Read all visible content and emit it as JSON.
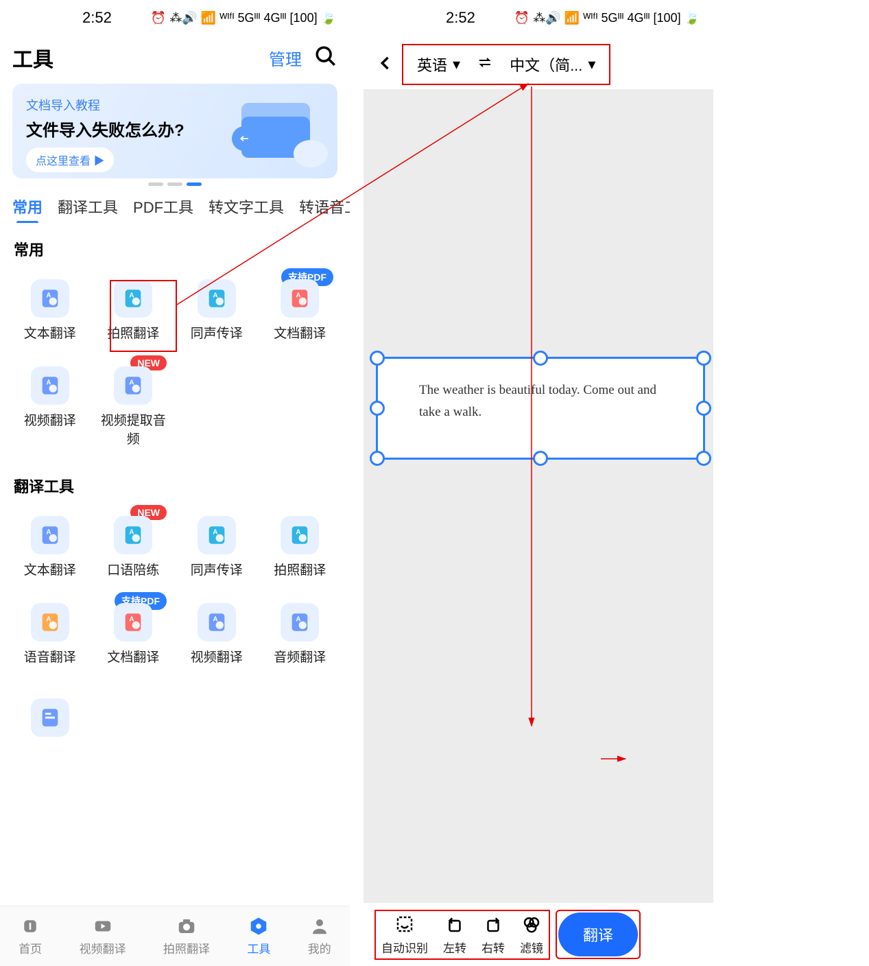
{
  "status": {
    "time": "2:52",
    "icons": "⏰ ⁂🔊 📶 ᵂᴵᶠᴵ 5Gᴵᴵᴵ 4Gᴵᴵᴵ [100] 🍃"
  },
  "left": {
    "title": "工具",
    "manage": "管理",
    "banner": {
      "sub": "文档导入教程",
      "title": "文件导入失败怎么办?",
      "btn": "点这里查看 ▶"
    },
    "tabs": [
      "常用",
      "翻译工具",
      "PDF工具",
      "转文字工具",
      "转语音工具"
    ],
    "section1": "常用",
    "tools1": [
      {
        "label": "文本翻译",
        "color": "#6E9BFF"
      },
      {
        "label": "拍照翻译",
        "color": "#2FB5E8"
      },
      {
        "label": "同声传译",
        "color": "#2FB5E8"
      },
      {
        "label": "文档翻译",
        "color": "#FF6B6B",
        "badge": "支持PDF",
        "badgeClass": "blue"
      },
      {
        "label": "视频翻译",
        "color": "#6E9BFF"
      },
      {
        "label": "视频提取音频",
        "color": "#6E9BFF",
        "badge": "NEW",
        "badgeClass": "red"
      }
    ],
    "section2": "翻译工具",
    "tools2": [
      {
        "label": "文本翻译",
        "color": "#6E9BFF"
      },
      {
        "label": "口语陪练",
        "color": "#2FB5E8",
        "badge": "NEW",
        "badgeClass": "red"
      },
      {
        "label": "同声传译",
        "color": "#2FB5E8"
      },
      {
        "label": "拍照翻译",
        "color": "#2FB5E8"
      },
      {
        "label": "语音翻译",
        "color": "#FFA94D"
      },
      {
        "label": "文档翻译",
        "color": "#FF6B6B",
        "badge": "支持PDF",
        "badgeClass": "blue"
      },
      {
        "label": "视频翻译",
        "color": "#6E9BFF"
      },
      {
        "label": "音频翻译",
        "color": "#6E9BFF"
      }
    ],
    "nav": [
      "首页",
      "视频翻译",
      "拍照翻译",
      "工具",
      "我的"
    ]
  },
  "right": {
    "langFrom": "英语",
    "langTo": "中文（简...",
    "cropText": "The weather is beautiful today. Come out and take a walk.",
    "tools": [
      "自动识别",
      "左转",
      "右转",
      "滤镜"
    ],
    "translateBtn": "翻译"
  }
}
